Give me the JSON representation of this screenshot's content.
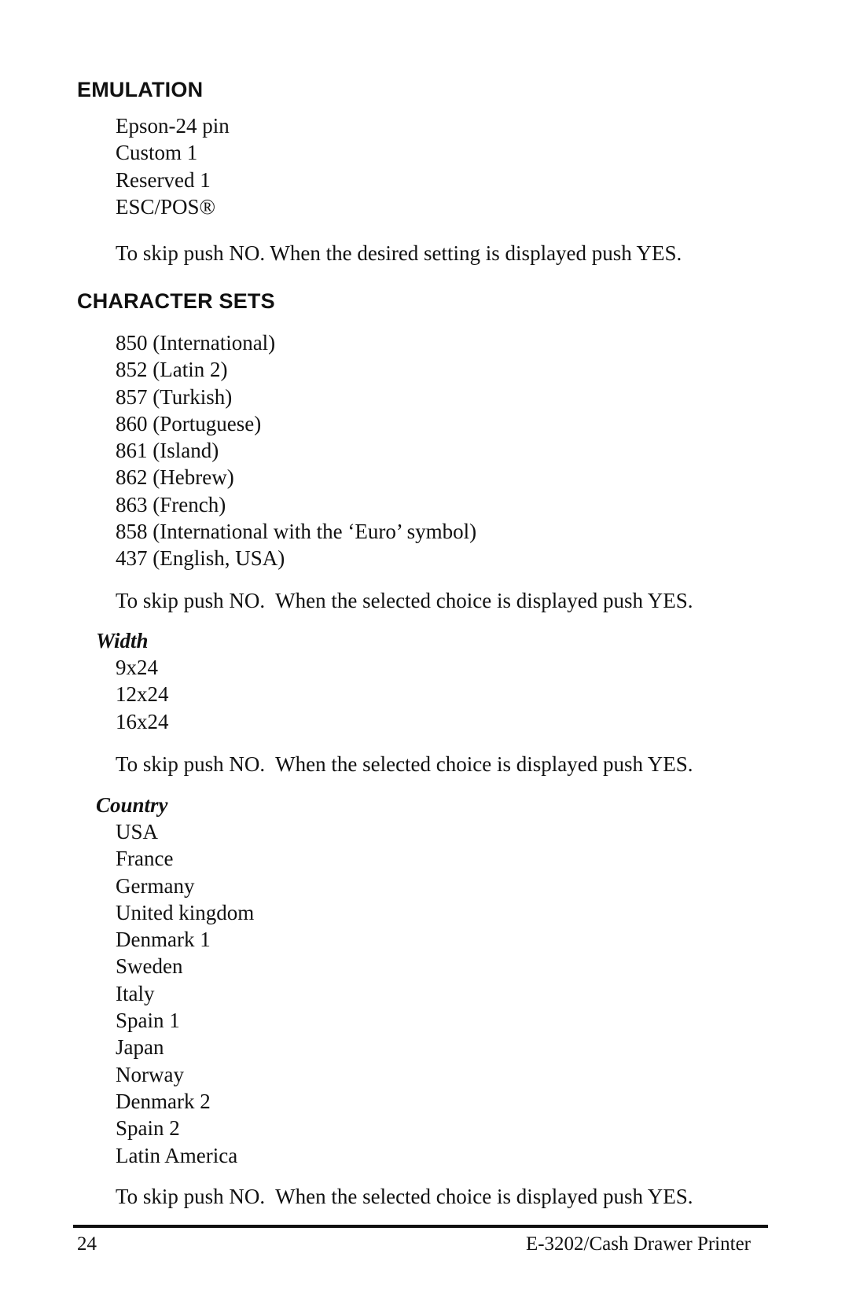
{
  "emulation": {
    "heading": "EMULATION",
    "options": [
      "Epson-24 pin",
      "Custom 1",
      "Reserved 1",
      "ESC/POS®"
    ],
    "instruction": "To skip push NO. When the desired setting is displayed push YES."
  },
  "character_sets": {
    "heading": "CHARACTER SETS",
    "options": [
      "850 (International)",
      "852 (Latin 2)",
      "857 (Turkish)",
      "860 (Portuguese)",
      "861 (Island)",
      "862 (Hebrew)",
      "863 (French)",
      "858 (International with the ‘Euro’ symbol)",
      "437 (English, USA)"
    ],
    "instruction": "To skip push NO.  When the selected choice is displayed push YES."
  },
  "width": {
    "heading": "Width",
    "options": [
      "9x24",
      "12x24",
      "16x24"
    ],
    "instruction": "To skip push NO.  When the selected choice is displayed push YES."
  },
  "country": {
    "heading": "Country",
    "options": [
      "USA",
      "France",
      "Germany",
      "United kingdom",
      "Denmark 1",
      "Sweden",
      "Italy",
      "Spain 1",
      "Japan",
      "Norway",
      "Denmark 2",
      "Spain 2",
      "Latin America"
    ],
    "instruction": "To skip push NO.  When the selected choice is displayed push YES."
  },
  "footer": {
    "page_number": "24",
    "document_title": "E-3202/Cash Drawer Printer"
  }
}
